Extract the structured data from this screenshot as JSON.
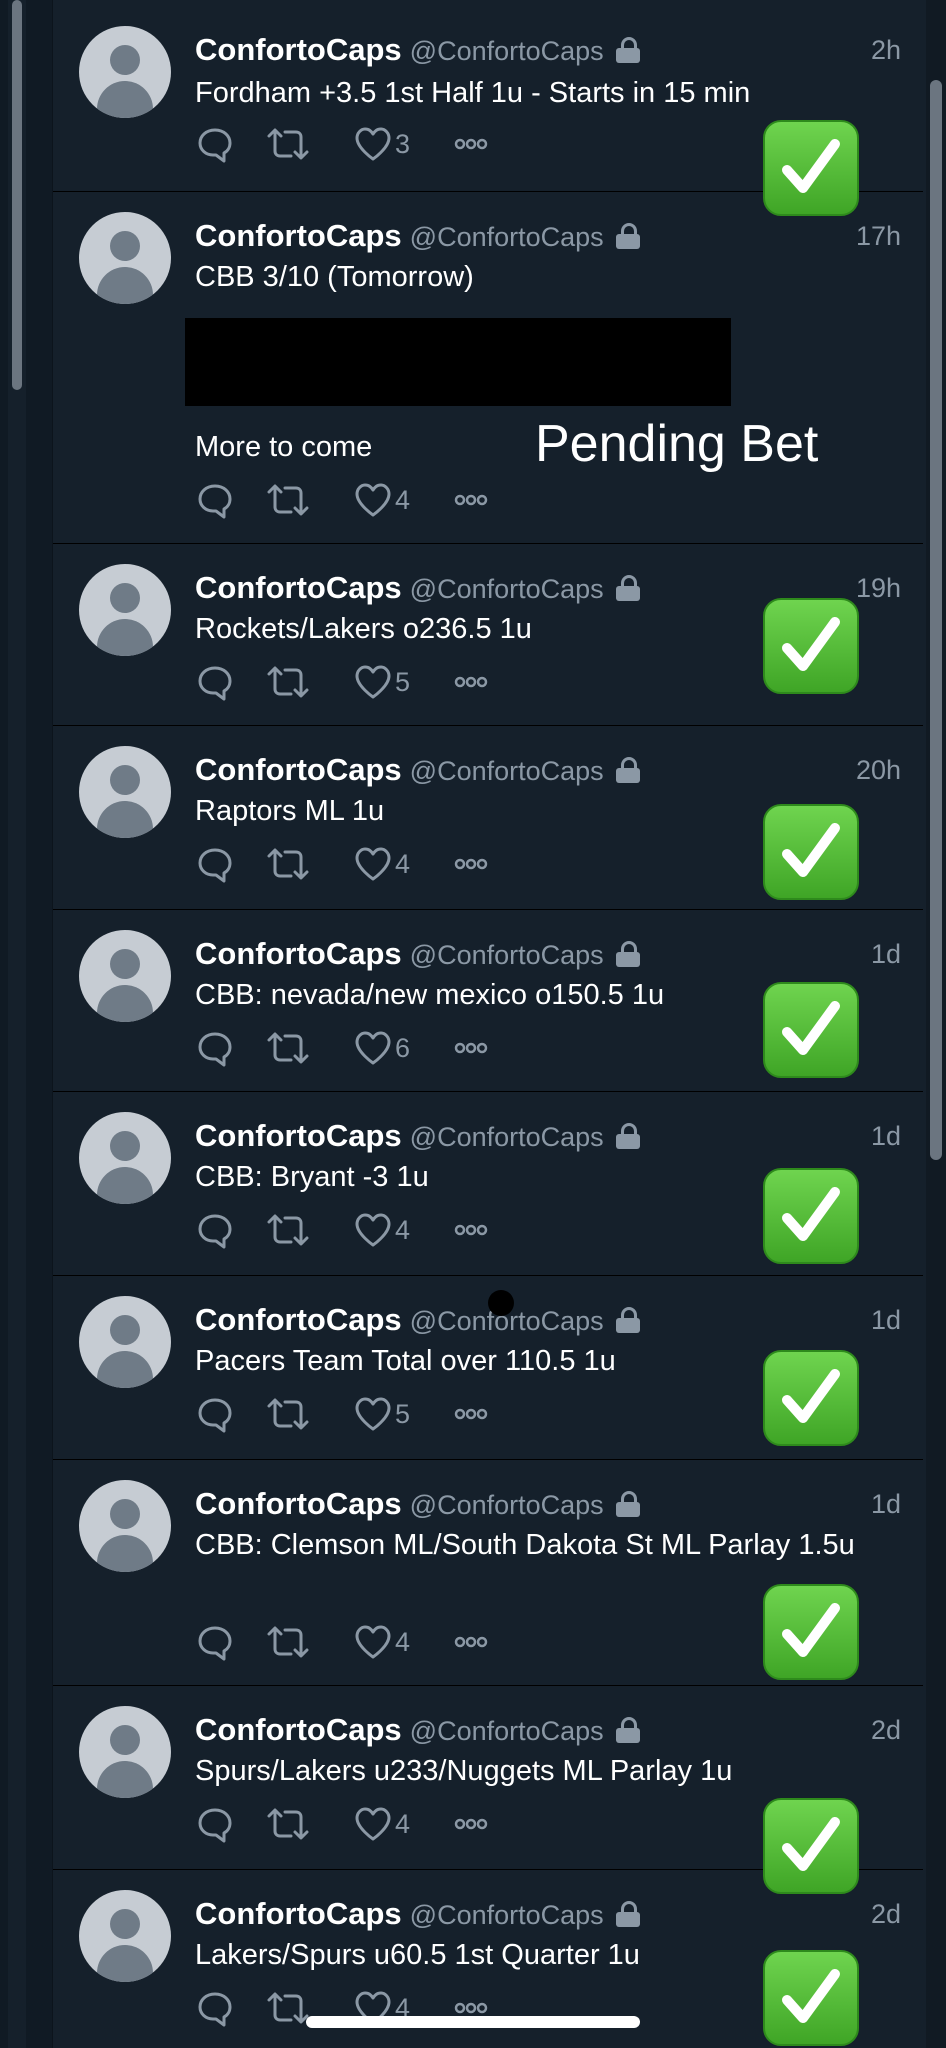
{
  "tweets": [
    {
      "name": "ConfortoCaps",
      "handle": "@ConfortoCaps",
      "time": "2h",
      "text": "Fordham +3.5 1st Half 1u - Starts in 15 min",
      "likes": "3",
      "result": "check"
    },
    {
      "name": "ConfortoCaps",
      "handle": "@ConfortoCaps",
      "time": "17h",
      "text": "CBB 3/10 (Tomorrow)",
      "extra": "More to come",
      "overlay": "Pending Bet",
      "likes": "4"
    },
    {
      "name": "ConfortoCaps",
      "handle": "@ConfortoCaps",
      "time": "19h",
      "text": "Rockets/Lakers o236.5 1u",
      "likes": "5",
      "result": "check"
    },
    {
      "name": "ConfortoCaps",
      "handle": "@ConfortoCaps",
      "time": "20h",
      "text": "Raptors ML 1u",
      "likes": "4",
      "result": "check"
    },
    {
      "name": "ConfortoCaps",
      "handle": "@ConfortoCaps",
      "time": "1d",
      "text": "CBB: nevada/new mexico o150.5 1u",
      "likes": "6",
      "result": "check"
    },
    {
      "name": "ConfortoCaps",
      "handle": "@ConfortoCaps",
      "time": "1d",
      "text": "CBB: Bryant -3 1u",
      "likes": "4",
      "result": "check"
    },
    {
      "name": "ConfortoCaps",
      "handle": "@ConfortoCaps",
      "time": "1d",
      "text": "Pacers Team Total over 110.5 1u",
      "likes": "5",
      "result": "check"
    },
    {
      "name": "ConfortoCaps",
      "handle": "@ConfortoCaps",
      "time": "1d",
      "text": "CBB: Clemson ML/South Dakota St ML Parlay 1.5u",
      "likes": "4",
      "result": "check"
    },
    {
      "name": "ConfortoCaps",
      "handle": "@ConfortoCaps",
      "time": "2d",
      "text": "Spurs/Lakers u233/Nuggets ML Parlay 1u",
      "likes": "4",
      "result": "check"
    },
    {
      "name": "ConfortoCaps",
      "handle": "@ConfortoCaps",
      "time": "2d",
      "text": "Lakers/Spurs u60.5 1st Quarter 1u",
      "likes": "4",
      "result": "check"
    }
  ],
  "colors": {
    "background": "#15202b",
    "text": "#ffffff",
    "muted": "#8b98a5",
    "check": "#4cbb2f"
  },
  "icons": [
    "reply-icon",
    "retweet-icon",
    "like-icon",
    "more-icon",
    "lock-icon",
    "checkmark-icon"
  ]
}
